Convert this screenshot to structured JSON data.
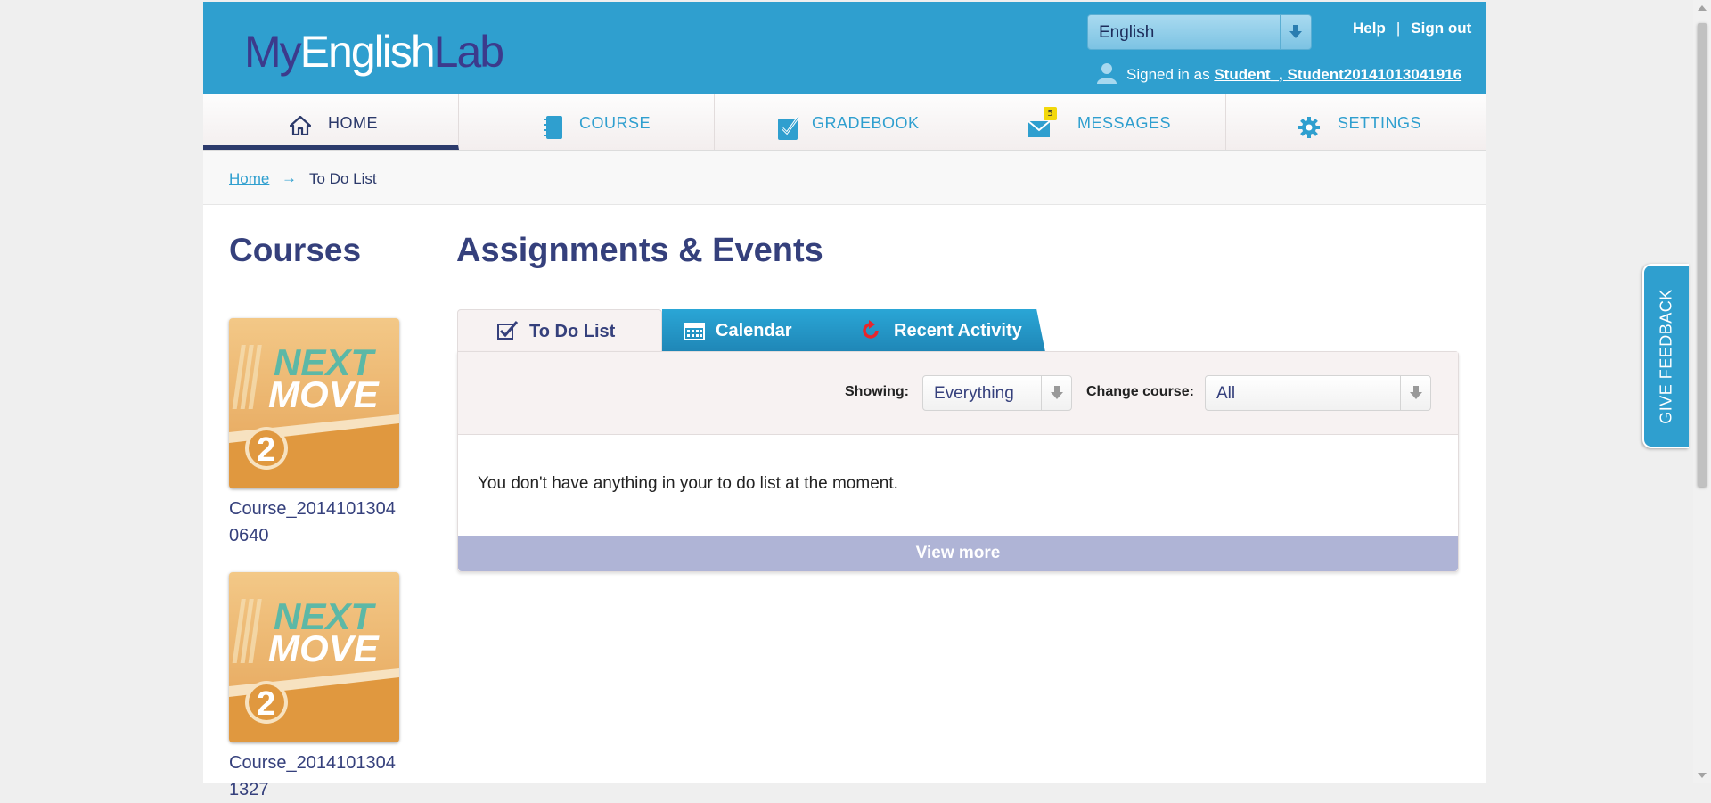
{
  "header": {
    "logo": {
      "my": "My",
      "english": "English",
      "lab": "Lab"
    },
    "language": "English",
    "help": "Help",
    "separator": "|",
    "sign_out": "Sign out",
    "signed_in_as": "Signed in as",
    "user_name": "Student_, Student20141013041916"
  },
  "nav": {
    "items": [
      {
        "label": "HOME",
        "icon": "home-icon",
        "active": true
      },
      {
        "label": "COURSE",
        "icon": "book-icon"
      },
      {
        "label": "GRADEBOOK",
        "icon": "gradebook-icon"
      },
      {
        "label": "MESSAGES",
        "icon": "envelope-icon",
        "badge": "5"
      },
      {
        "label": "SETTINGS",
        "icon": "gear-icon"
      }
    ]
  },
  "breadcrumb": {
    "home": "Home",
    "arrow": "→",
    "current": "To Do List"
  },
  "sidebar": {
    "title": "Courses",
    "courses": [
      {
        "name": "Course_20141013040640",
        "cover": {
          "line1": "NEXT",
          "line2": "MOVE",
          "level": "2"
        }
      },
      {
        "name": "Course_20141013041327",
        "cover": {
          "line1": "NEXT",
          "line2": "MOVE",
          "level": "2"
        }
      }
    ]
  },
  "main": {
    "title": "Assignments & Events",
    "tabs": [
      {
        "label": "To Do List",
        "icon": "checkbox-icon",
        "active": true
      },
      {
        "label": "Calendar",
        "icon": "calendar-icon"
      },
      {
        "label": "Recent Activity",
        "icon": "refresh-icon"
      }
    ],
    "filters": {
      "showing_label": "Showing:",
      "showing_value": "Everything",
      "course_label": "Change course:",
      "course_value": "All"
    },
    "empty_message": "You don't have anything in your to do list at the moment.",
    "view_more": "View more"
  },
  "feedback": {
    "label": "GIVE FEEDBACK"
  },
  "colors": {
    "header_bg": "#2f9fcf",
    "brand_dark": "#35407c",
    "view_more_bg": "#afb4d6",
    "badge": "#f2d80b"
  }
}
